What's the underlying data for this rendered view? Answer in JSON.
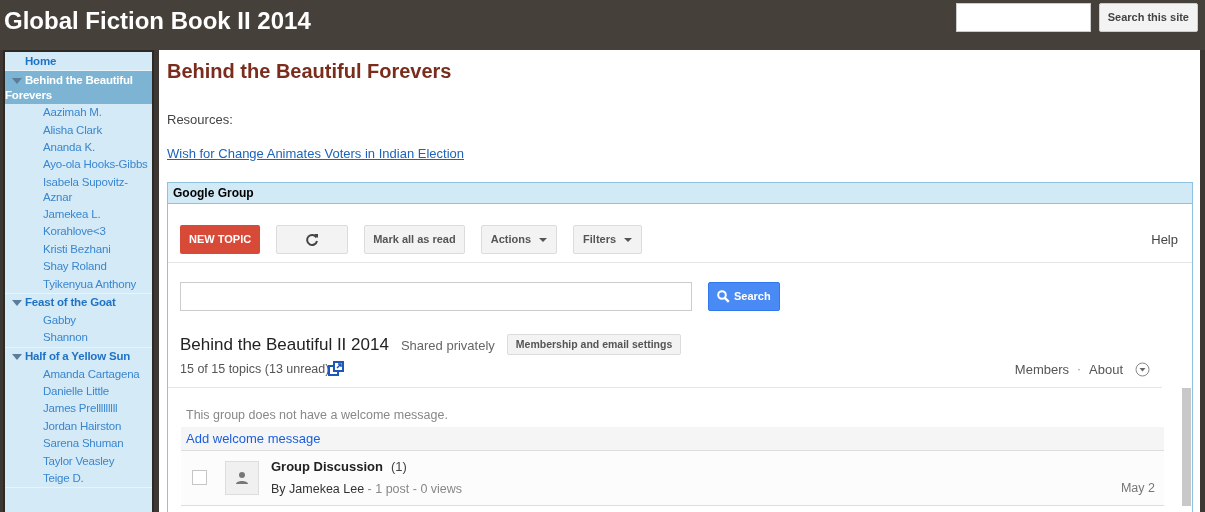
{
  "header": {
    "site_title": "Global Fiction Book II 2014",
    "search": {
      "button": "Search this site"
    }
  },
  "sidebar": {
    "items": [
      {
        "label": "Home",
        "selected": false
      },
      {
        "label": "Behind the Beautiful Forevers",
        "selected": true,
        "expanded": true,
        "children": [
          {
            "label": "Aazimah M.",
            "selected": false
          },
          {
            "label": "Alisha Clark",
            "selected": false
          },
          {
            "label": "Ananda K.",
            "selected": false
          },
          {
            "label": "Ayo-ola Hooks-Gibbs",
            "selected": false
          },
          {
            "label": "Isabela Supovitz-Aznar",
            "selected": false
          },
          {
            "label": "Jamekea L.",
            "selected": false
          },
          {
            "label": "Korahlove<3",
            "selected": false
          },
          {
            "label": "Kristi Bezhani",
            "selected": false
          },
          {
            "label": "Shay Roland",
            "selected": false
          },
          {
            "label": "Tyikenyua Anthony",
            "selected": false
          }
        ]
      },
      {
        "label": "Feast of the Goat",
        "selected": false,
        "expanded": true,
        "children": [
          {
            "label": "Gabby",
            "selected": false
          },
          {
            "label": "Shannon",
            "selected": false
          }
        ]
      },
      {
        "label": "Half of a Yellow Sun",
        "selected": false,
        "expanded": true,
        "children": [
          {
            "label": "Amanda Cartagena",
            "selected": false
          },
          {
            "label": "Danielle Little",
            "selected": false
          },
          {
            "label": "James Prelllllllll",
            "selected": false
          },
          {
            "label": "Jordan Hairston",
            "selected": false
          },
          {
            "label": "Sarena Shuman",
            "selected": false
          },
          {
            "label": "Taylor Veasley",
            "selected": false
          },
          {
            "label": "Teige D.",
            "selected": false
          }
        ]
      }
    ]
  },
  "page": {
    "title": "Behind the Beautiful Forevers",
    "resources_label": "Resources:",
    "link": "Wish for Change Animates Voters in Indian Election"
  },
  "group": {
    "header": "Google Group",
    "toolbar": [
      {
        "kind": "primary",
        "label": "NEW TOPIC"
      },
      {
        "kind": "refresh"
      },
      {
        "kind": "plain",
        "label": "Mark all as read"
      },
      {
        "kind": "dropdown",
        "label": "Actions"
      },
      {
        "kind": "dropdown",
        "label": "Filters"
      }
    ],
    "help": "Help",
    "search_button": "Search",
    "name": "Behind the Beautiful II 2014",
    "sharing": "Shared privately",
    "membership_button": "Membership and email settings",
    "topic_count": "15 of 15 topics (13 unread)",
    "members": "Members",
    "separator": "·",
    "about": "About",
    "welcome": "This group does not have a welcome message.",
    "add_welcome": "Add welcome message",
    "topics": [
      {
        "title": "Group Discussion",
        "count": "(1)",
        "author": "By Jamekea Lee",
        "stats": " - 1 post - 0 views",
        "date": "May 2",
        "checked": false
      }
    ]
  }
}
